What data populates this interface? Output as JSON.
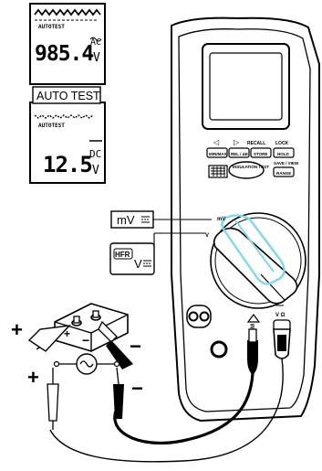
{
  "display_top": {
    "mode_text": "AUTOTEST",
    "reading": "985.4",
    "unit_top": "AC",
    "unit_bottom": "V"
  },
  "auto_test_label": "AUTO TEST",
  "display_bottom": {
    "mode_text": "AUTOTEST",
    "reading": "12.5",
    "unit_top": "DC",
    "unit_bottom": "V"
  },
  "meter_buttons": {
    "left_arrow": "◁",
    "right_arrow": "▷",
    "recall": "RECALL",
    "lock": "LOCK",
    "minmax": "MIN/MAX",
    "rel": "REL / ΔE",
    "store": "STORE",
    "hold": "HOLD",
    "range_top": "SAVE / VIEW",
    "range": "RANGE",
    "insulation_test": "INSULATION TEST"
  },
  "dial_labels": {
    "mv": "mV",
    "v": "V"
  },
  "side_labels": {
    "mv_label": "mV",
    "hfr_label": "HFR",
    "hfr_v": "V"
  },
  "jack_labels": {
    "com": "COM",
    "v_ohm": "V Ω"
  },
  "polarity": {
    "plus": "+",
    "minus": "−"
  },
  "colors": {
    "highlight": "#7fd9ea",
    "black": "#000000"
  }
}
